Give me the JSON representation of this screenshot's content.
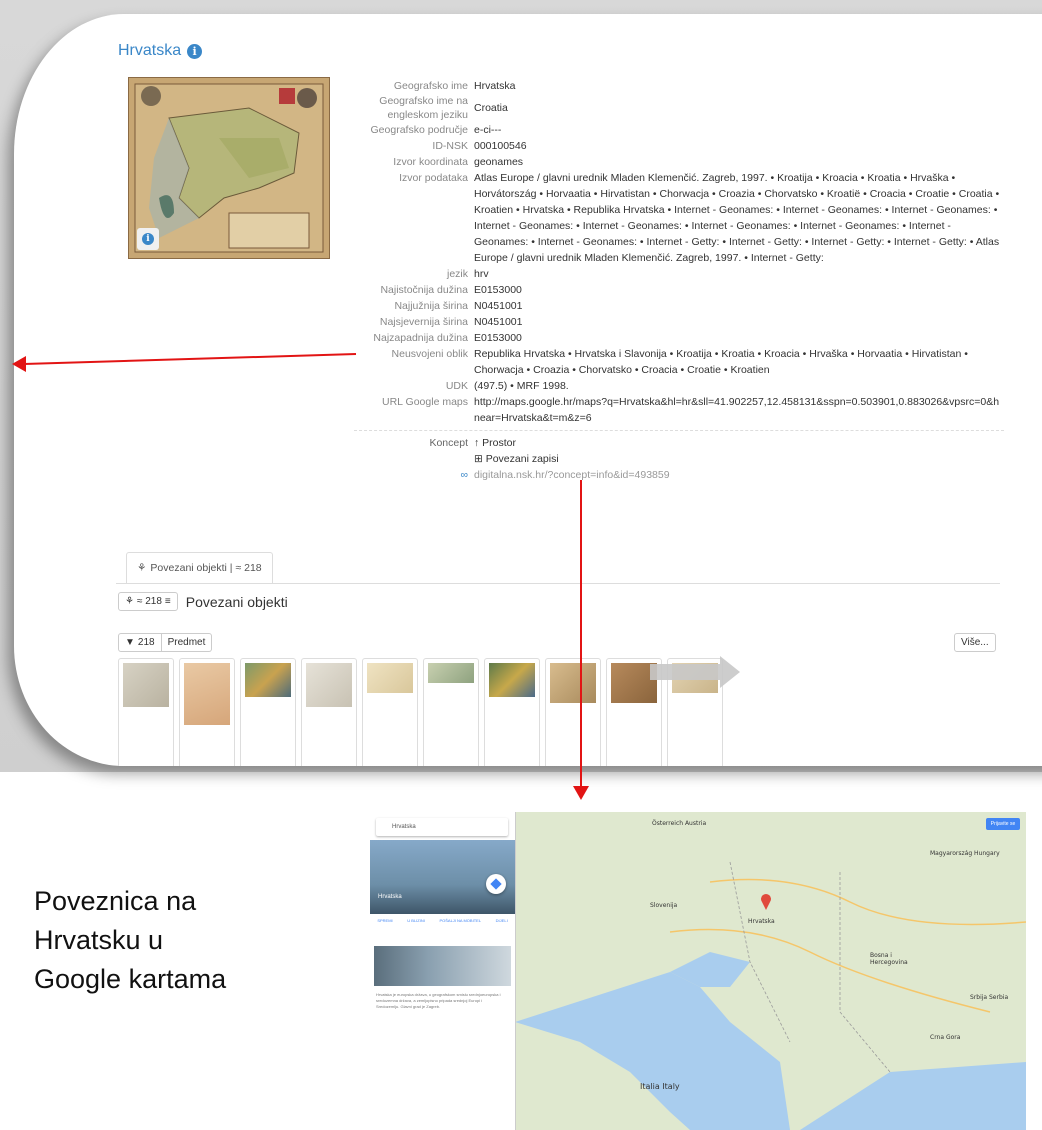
{
  "page": {
    "title": "Hrvatska",
    "fields": [
      {
        "label": "Geografsko ime",
        "value": "Hrvatska"
      },
      {
        "label": "Geografsko ime na engleskom jeziku",
        "value": "Croatia"
      },
      {
        "label": "Geografsko područje",
        "value": "e-ci---"
      },
      {
        "label": "ID-NSK",
        "value": "000100546"
      },
      {
        "label": "Izvor koordinata",
        "value": "geonames"
      },
      {
        "label": "Izvor podataka",
        "value": "Atlas Europe / glavni urednik Mladen Klemenčić. Zagreb, 1997.  • Kroatija  • Kroacia  • Kroatia  • Hrvaška  • Horvátország  • Horvaatia  • Hirvatistan  • Chorwacja  • Croazia  • Chorvatsko  • Kroatië  • Croacia  • Croatie  • Croatia  • Kroatien  • Hrvatska  • Republika Hrvatska  • Internet - Geonames:  • Internet - Geonames:  • Internet - Geonames:  • Internet - Geonames:  • Internet - Geonames:  • Internet - Geonames:  • Internet - Geonames:  • Internet - Geonames:  • Internet - Geonames:  • Internet - Getty:  • Internet - Getty:  • Internet - Getty:  • Internet - Getty:  • Atlas Europe / glavni urednik Mladen Klemenčić. Zagreb, 1997.  • Internet - Getty:"
      },
      {
        "label": "jezik",
        "value": "hrv"
      },
      {
        "label": "Najistočnija dužina",
        "value": "E0153000"
      },
      {
        "label": "Najjužnija širina",
        "value": "N0451001"
      },
      {
        "label": "Najsjevernija širina",
        "value": "N0451001"
      },
      {
        "label": "Najzapadnija dužina",
        "value": "E0153000"
      },
      {
        "label": "Neusvojeni oblik",
        "value": "Republika Hrvatska  • Hrvatska i Slavonija  • Kroatija  • Kroatia  • Kroacia  • Hrvaška  • Horvaatia  • Hirvatistan  • Chorwacja  • Croazia  • Chorvatsko  • Croacia  • Croatie  • Kroatien"
      },
      {
        "label": "UDK",
        "value": "(497.5)  • MRF 1998."
      },
      {
        "label": "URL Google maps",
        "value": "http://maps.google.hr/maps?q=Hrvatska&hl=hr&sll=41.902257,12.458131&sspn=0.503901,0.883026&vpsrc=0&hnear=Hrvatska&t=m&z=6"
      }
    ],
    "koncept_label": "Koncept",
    "koncept_link": "Prostor",
    "povezani_zapisi": "Povezani zapisi",
    "permalink": "digitalna.nsk.hr/?concept=info&id=493859",
    "tab_label": "Povezani objekti | ≈ 218",
    "sub_count": "≈ 218",
    "sub_title": "Povezani objekti",
    "filter_count": "218",
    "filter_label": "Predmet",
    "more_button": "Više..."
  },
  "caption": {
    "line1": "Poveznica na",
    "line2": "Hrvatsku u",
    "line3": "Google kartama"
  },
  "maps": {
    "search": "Hrvatska",
    "place": "Hrvatska",
    "actions": [
      "SPREMI",
      "U BLIZINI",
      "POŠALJI NA MOBITEL",
      "DIJELI"
    ],
    "about": "Hrvatska je europska država, u geografskom smislu srednjoeuropska i sredozemna država, a zemljopisno pripada srednjoj Europi i Sredozemlju. Glavni grad je Zagreb.",
    "cities": [
      "Österreich Austria",
      "Magyarország Hungary",
      "Slovenija",
      "Hrvatska",
      "Bosna i Hercegovina",
      "Srbija Serbia",
      "Italia Italy",
      "Crna Gora"
    ],
    "sign_in": "Prijavite se"
  },
  "colors": {
    "accent": "#3a87c8",
    "red_arrow": "#e21414"
  }
}
